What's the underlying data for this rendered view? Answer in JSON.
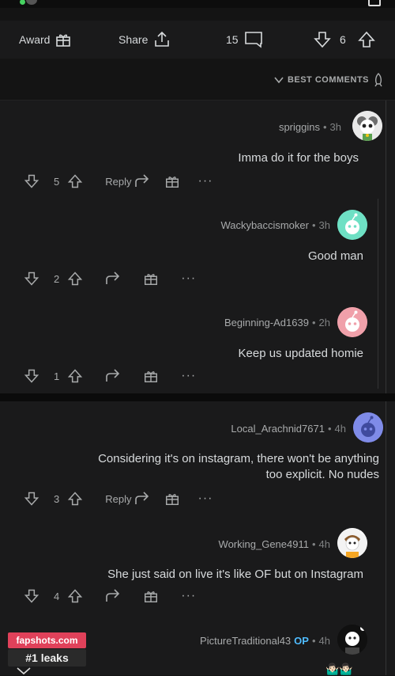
{
  "action_bar": {
    "award_label": "Award",
    "share_label": "Share",
    "comment_count": "15",
    "vote_count": "6"
  },
  "sort": {
    "label": "BEST COMMENTS"
  },
  "comments": [
    {
      "user": "spriggins",
      "age": "3h",
      "text": "Imma do it for the boys",
      "votes": "5",
      "reply_label": "Reply"
    },
    {
      "user": "Wackybaccismoker",
      "age": "3h",
      "text": "Good man",
      "votes": "2"
    },
    {
      "user": "Beginning-Ad1639",
      "age": "2h",
      "text": "Keep us updated homie",
      "votes": "1"
    },
    {
      "user": "Local_Arachnid7671",
      "age": "4h",
      "text_line1": "Considering it's on instagram, there won't be anything",
      "text_line2": "too explicit. No nudes",
      "votes": "3",
      "reply_label": "Reply"
    },
    {
      "user": "Working_Gene4911",
      "age": "4h",
      "text": "She just said on live it's like OF but on Instagram",
      "votes": "4"
    },
    {
      "user": "PictureTraditional43",
      "op_badge": "OP",
      "age": "4h"
    }
  ],
  "watermark": {
    "line1": "fapshots.com",
    "line2": "#1 leaks"
  },
  "colors": {
    "background": "#141414",
    "card": "#1a1a1b",
    "op_blue": "#4fbcff",
    "watermark_pink": "#e0415a"
  }
}
